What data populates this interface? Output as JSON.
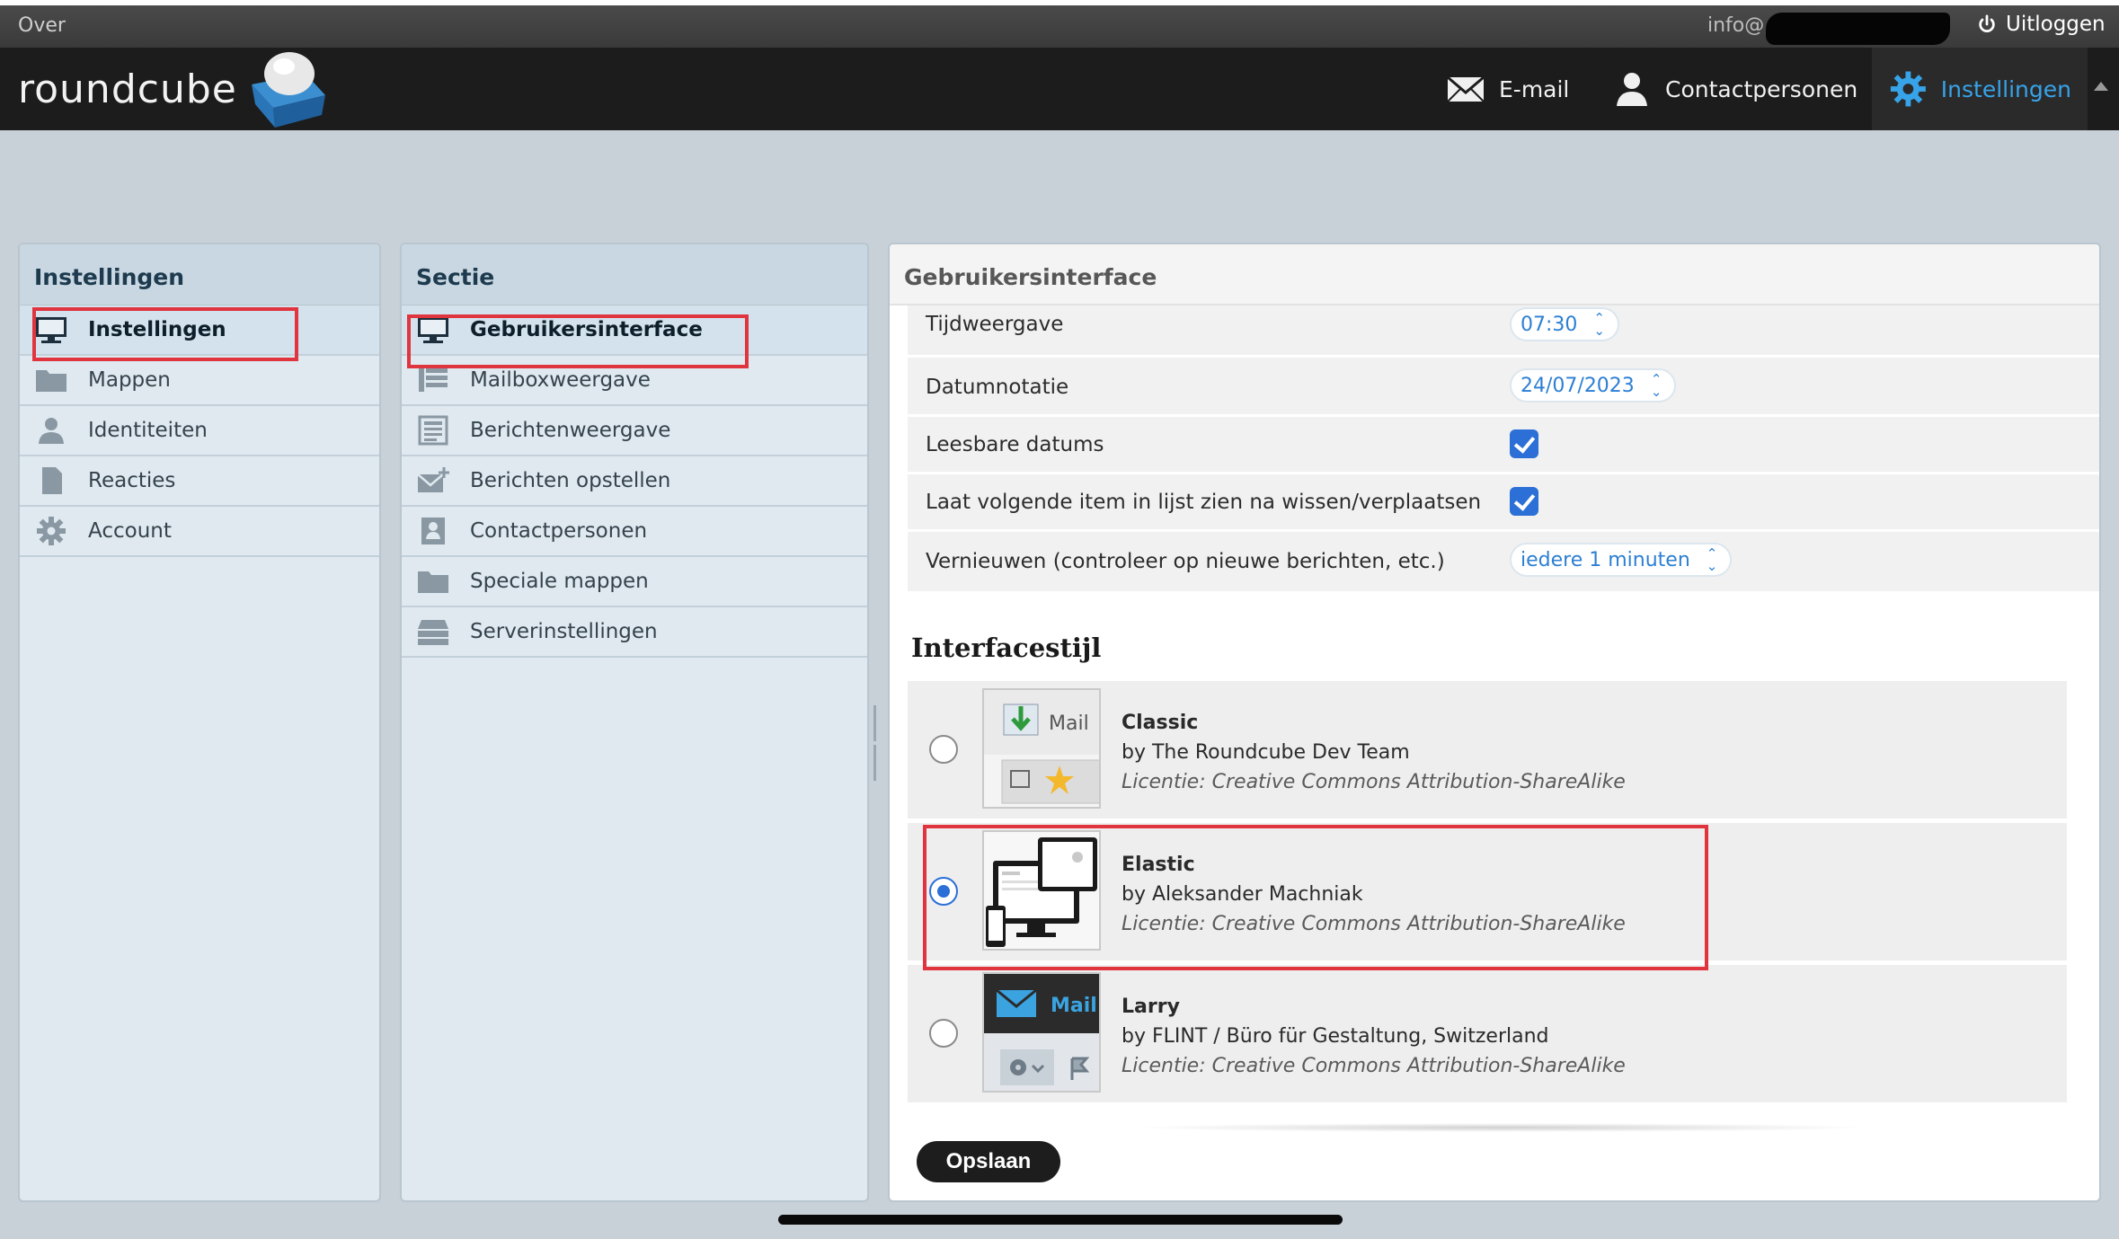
{
  "topbar": {
    "about": "Over",
    "user_email": "info@",
    "logout": "Uitloggen"
  },
  "header": {
    "logo_text": "roundcube",
    "tabs": [
      {
        "label": "E-mail",
        "icon": "envelope-icon"
      },
      {
        "label": "Contactpersonen",
        "icon": "person-icon"
      },
      {
        "label": "Instellingen",
        "icon": "gear-icon",
        "active": true
      }
    ],
    "active_color": "#37a3e8"
  },
  "settings_panel": {
    "title": "Instellingen",
    "items": [
      {
        "label": "Instellingen",
        "icon": "monitor-icon",
        "selected": true
      },
      {
        "label": "Mappen",
        "icon": "folder-icon"
      },
      {
        "label": "Identiteiten",
        "icon": "person-icon"
      },
      {
        "label": "Reacties",
        "icon": "document-icon"
      },
      {
        "label": "Account",
        "icon": "gear-icon"
      }
    ]
  },
  "section_panel": {
    "title": "Sectie",
    "items": [
      {
        "label": "Gebruikersinterface",
        "icon": "monitor-icon",
        "selected": true
      },
      {
        "label": "Mailboxweergave",
        "icon": "mailbox-list-icon"
      },
      {
        "label": "Berichtenweergave",
        "icon": "message-view-icon"
      },
      {
        "label": "Berichten opstellen",
        "icon": "compose-icon"
      },
      {
        "label": "Contactpersonen",
        "icon": "address-book-icon"
      },
      {
        "label": "Speciale mappen",
        "icon": "folder-icon"
      },
      {
        "label": "Serverinstellingen",
        "icon": "server-icon"
      }
    ]
  },
  "main_panel": {
    "title": "Gebruikersinterface",
    "rows": [
      {
        "label": "Tijdweergave",
        "type": "select",
        "value": "07:30"
      },
      {
        "label": "Datumnotatie",
        "type": "select",
        "value": "24/07/2023"
      },
      {
        "label": "Leesbare datums",
        "type": "checkbox",
        "checked": true
      },
      {
        "label": "Laat volgende item in lijst zien na wissen/verplaatsen",
        "type": "checkbox",
        "checked": true
      },
      {
        "label": "Vernieuwen (controleer op nieuwe berichten, etc.)",
        "type": "select",
        "value": "iedere 1 minuten"
      }
    ],
    "skin_heading": "Interfacestijl",
    "skins": [
      {
        "name": "Classic",
        "author": "by The Roundcube Dev Team",
        "license": "Licentie: Creative Commons Attribution-ShareAlike",
        "selected": false,
        "thumb_label": "Mail"
      },
      {
        "name": "Elastic",
        "author": "by Aleksander Machniak",
        "license": "Licentie: Creative Commons Attribution-ShareAlike",
        "selected": true
      },
      {
        "name": "Larry",
        "author": "by FLINT / Büro für Gestaltung, Switzerland",
        "license": "Licentie: Creative Commons Attribution-ShareAlike",
        "selected": false,
        "thumb_label": "Mail"
      }
    ],
    "save_label": "Opslaan"
  },
  "colors": {
    "highlight_box": "#e0343f",
    "checkbox_blue": "#2c6fd6"
  }
}
